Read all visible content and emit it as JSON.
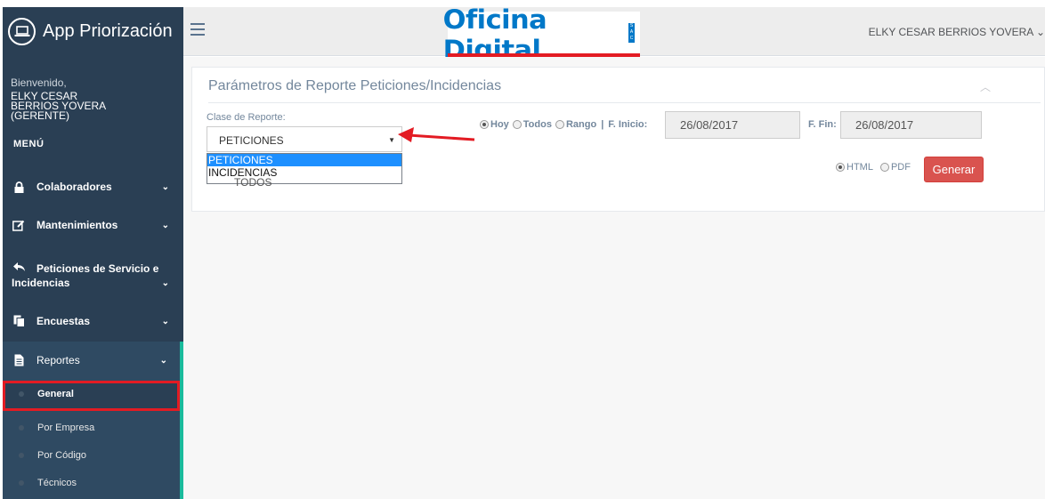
{
  "sidebar": {
    "brand_title": "App Priorización",
    "welcome_label": "Bienvenido,",
    "user_line1": "ELKY CESAR",
    "user_line2": "BERRIOS YOVERA",
    "user_line3": "(GERENTE)",
    "menu_title": "MENÚ",
    "items": [
      {
        "label": "Colaboradores",
        "icon": "lock-icon"
      },
      {
        "label": "Mantenimientos",
        "icon": "edit-icon"
      },
      {
        "label_line1": "Peticiones de Servicio e",
        "label_line2": "Incidencias",
        "icon": "reply-icon"
      },
      {
        "label": "Encuestas",
        "icon": "copy-icon"
      },
      {
        "label": "Reportes",
        "icon": "file-text-icon"
      }
    ],
    "report_subitems": [
      "General",
      "Por Empresa",
      "Por Código",
      "Técnicos"
    ]
  },
  "topbar": {
    "logo_text": "Oficina Digital",
    "logo_sac": "SAC",
    "user_name": "ELKY CESAR BERRIOS YOVERA ⌄"
  },
  "panel": {
    "title": "Parámetros de Reporte Peticiones/Incidencias",
    "clase_label": "Clase de Reporte:",
    "select_value": "PETICIONES",
    "dropdown_options": [
      "PETICIONES",
      "INCIDENCIAS"
    ],
    "dropdown_hidden_text": "TODOS",
    "radio_hoy": "Hoy",
    "radio_todos": "Todos",
    "radio_rango": "Rango",
    "separator": "|",
    "f_inicio_label": "F. Inicio:",
    "f_inicio_value": "26/08/2017",
    "f_fin_label": "F. Fin:",
    "f_fin_value": "26/08/2017",
    "format_html": "HTML",
    "format_pdf": "PDF",
    "generate_label": "Generar"
  },
  "colors": {
    "sidebar_bg": "#2a3f54",
    "accent_green": "#1abb9c",
    "button_red": "#d9534f",
    "highlight_red": "#e31b23",
    "logo_blue": "#0078c8"
  }
}
